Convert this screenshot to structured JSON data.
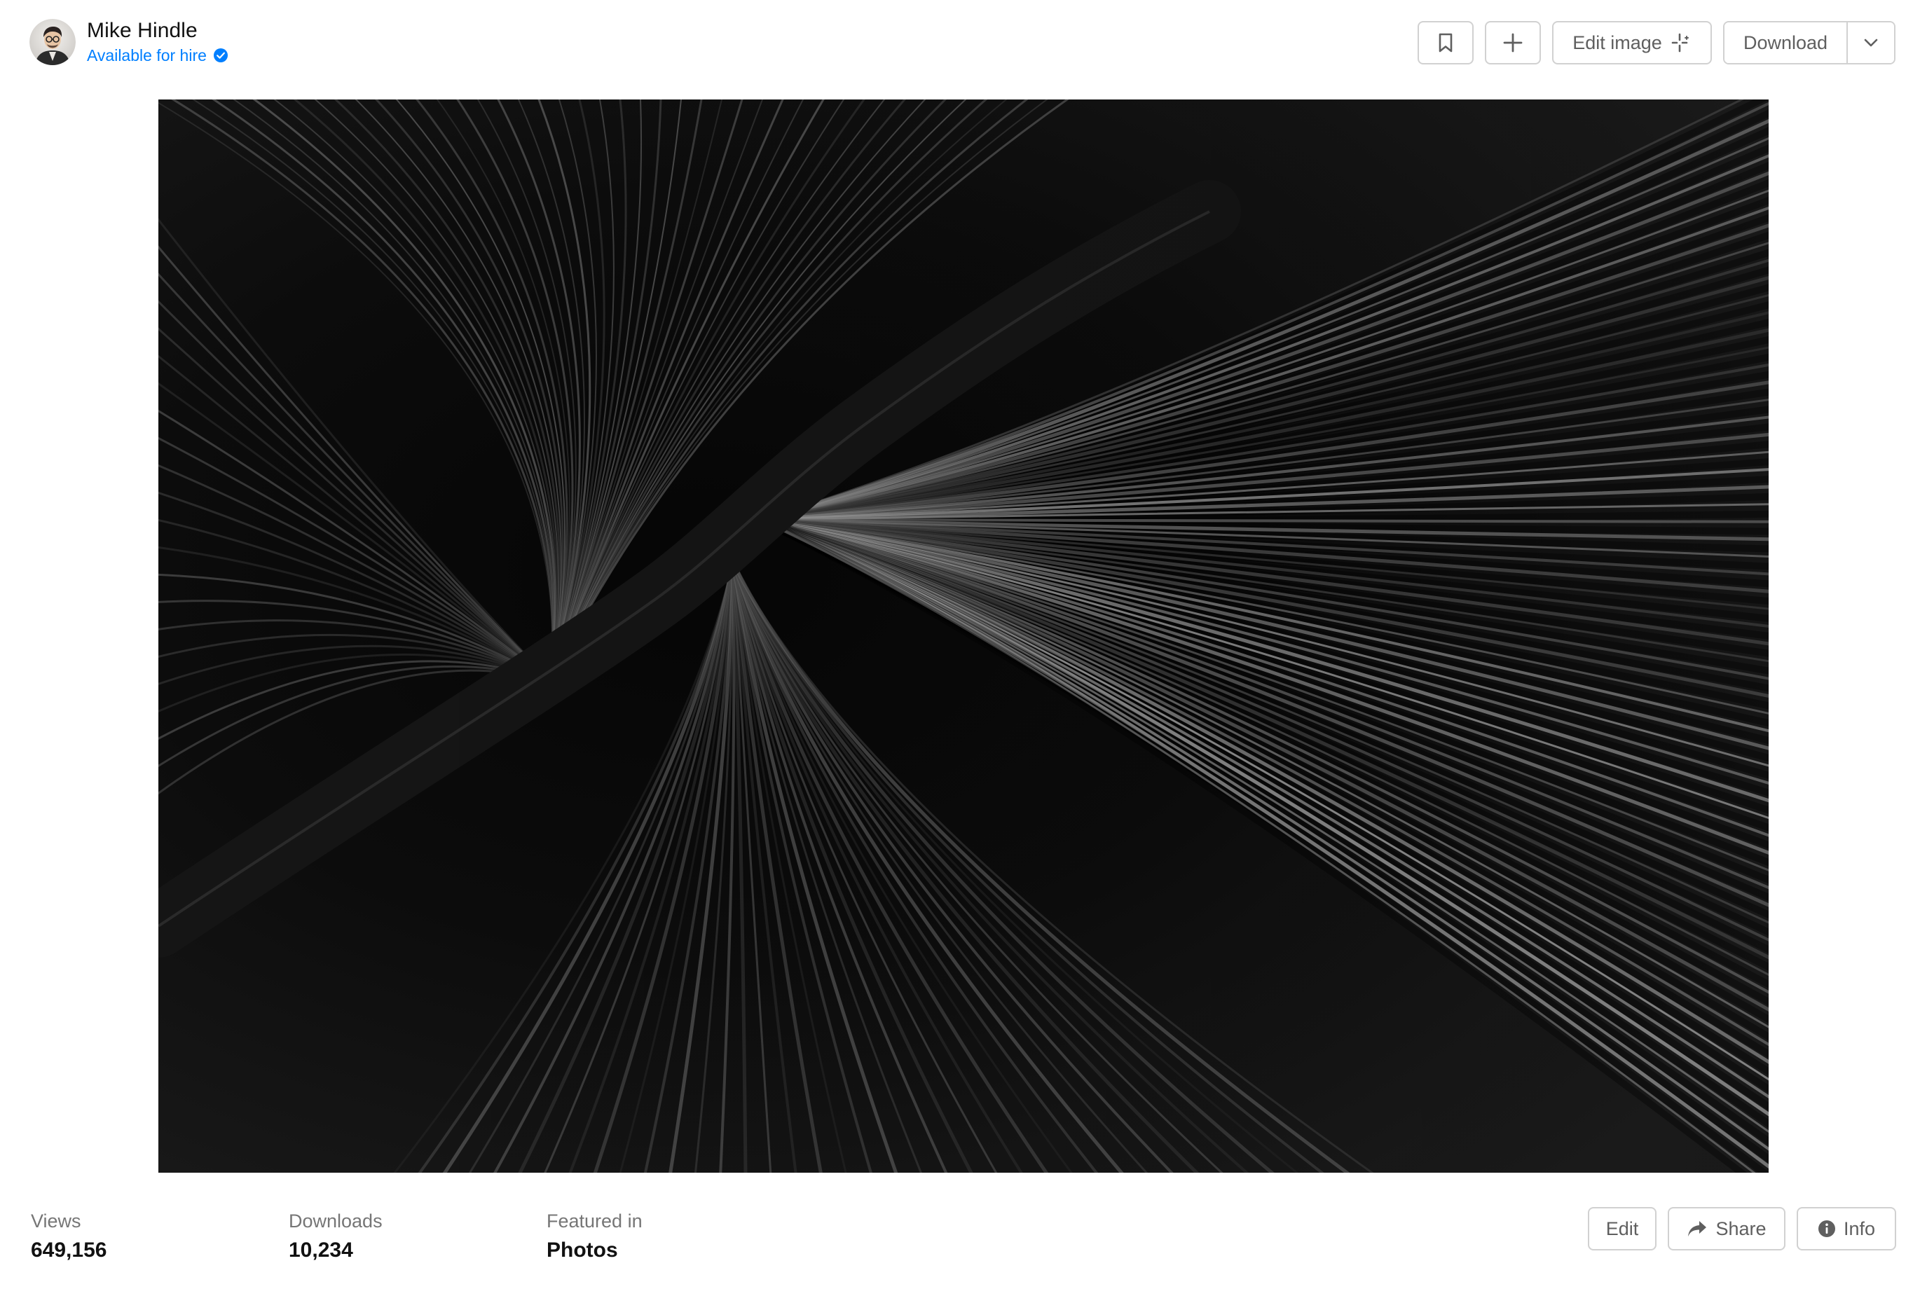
{
  "author": {
    "name": "Mike Hindle",
    "status": "Available for hire",
    "avatar_icon": "avatar-portrait-icon",
    "verified_icon": "verified-check-icon",
    "accent_color": "#007fff"
  },
  "toolbar": {
    "bookmark_icon": "bookmark-icon",
    "add_icon": "plus-icon",
    "edit_image_label": "Edit image",
    "edit_image_icon": "sparkle-icon",
    "download_label": "Download",
    "download_menu_icon": "chevron-down-icon"
  },
  "photo": {
    "subject_icon": "palm-leaf-photo"
  },
  "stats": [
    {
      "label": "Views",
      "value": "649,156"
    },
    {
      "label": "Downloads",
      "value": "10,234"
    },
    {
      "label": "Featured in",
      "value": "Photos"
    }
  ],
  "actions": {
    "edit_label": "Edit",
    "share_label": "Share",
    "share_icon": "share-arrow-icon",
    "info_label": "Info",
    "info_icon": "info-circle-icon"
  }
}
